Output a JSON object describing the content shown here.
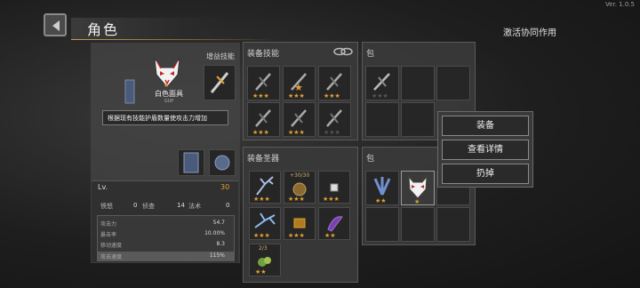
{
  "version": "Ver. 1.0.5",
  "header": {
    "title": "角色",
    "sync_label": "激活协同作用"
  },
  "character": {
    "item_name": "白色面具",
    "item_sub": "GUP",
    "tooltip": "根据现有技能护盾数量使攻击力增加",
    "gems_label": "增益技能",
    "level_label": "Lv.",
    "level_value": "30",
    "row2_left_label": "愤怒",
    "row2_left_value": "0",
    "row2_mid_label": "侦查",
    "row2_right_value": "14",
    "row2_right_label": "法术",
    "row2_right_value2": "0",
    "stats": [
      {
        "label": "攻击力",
        "value": "54.7"
      },
      {
        "label": "暴击率",
        "value": "10.00%"
      },
      {
        "label": "移动速度",
        "value": "8.3"
      },
      {
        "label": "攻击速度",
        "value": "115%"
      }
    ]
  },
  "skills": {
    "label": "装备技能",
    "link_icon": "link-icon",
    "slots": [
      {
        "icon": "crossbow-icon",
        "stars": 3
      },
      {
        "icon": "crossbow-gold-icon",
        "stars": 3
      },
      {
        "icon": "crossbow-icon",
        "stars": 3
      },
      {
        "icon": "crossbow-icon",
        "stars": 3
      },
      {
        "icon": "crossbow-icon",
        "stars": 3
      },
      {
        "icon": "crossbow-icon",
        "stars": 0
      }
    ]
  },
  "equipment": {
    "label": "装备圣器",
    "slots": [
      {
        "icon": "antler-icon",
        "stars": 3,
        "count": ""
      },
      {
        "icon": "bomb-icon",
        "stars": 3,
        "count": "+30/30"
      },
      {
        "icon": "dice-icon",
        "stars": 3,
        "count": ""
      },
      {
        "icon": "ice-antler-icon",
        "stars": 3,
        "count": ""
      },
      {
        "icon": "chest-icon",
        "stars": 3,
        "count": ""
      },
      {
        "icon": "purple-horn-icon",
        "stars": 2,
        "count": ""
      },
      {
        "icon": "potion-icon",
        "stars": 2,
        "count": "2/3"
      }
    ]
  },
  "bag1": {
    "label": "包",
    "slots": [
      {
        "icon": "crossbow-icon",
        "stars": 0
      }
    ]
  },
  "bag2": {
    "label": "包",
    "slots": [
      {
        "icon": "feather-icon",
        "stars": 2
      },
      {
        "icon": "fox-mask-icon",
        "stars": 1
      }
    ]
  },
  "context_menu": {
    "equip": "装备",
    "details": "查看详情",
    "discard": "扔掉"
  },
  "colors": {
    "accent": "#e0a030",
    "underline": "#c8a050"
  }
}
